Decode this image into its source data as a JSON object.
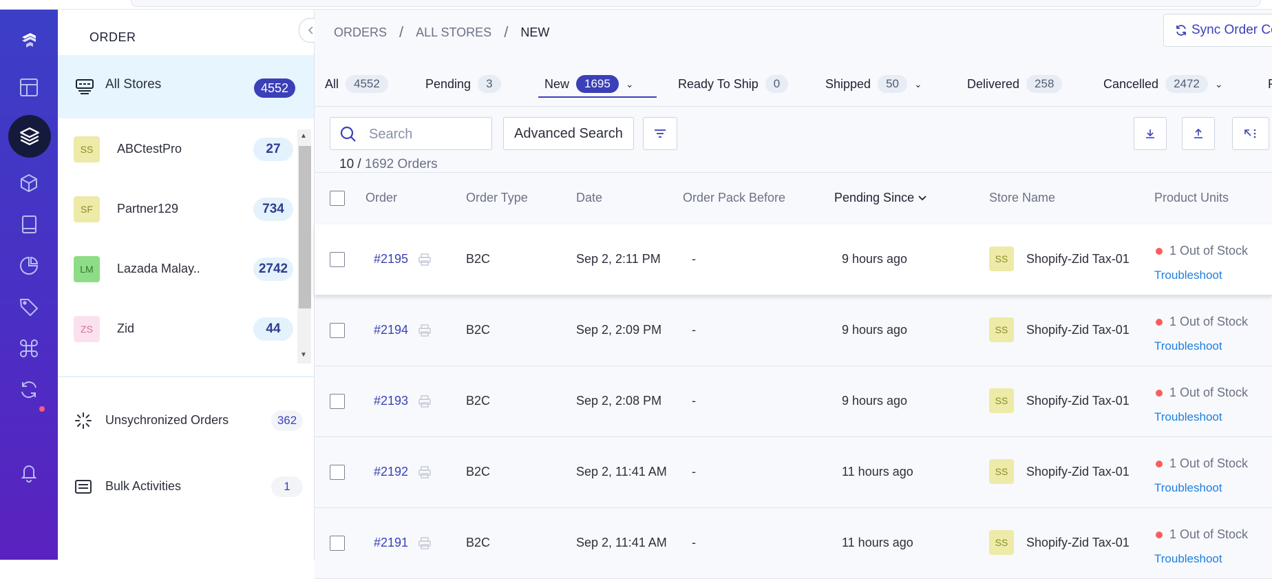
{
  "sidebar_rail": {
    "icons": [
      "logo-icon",
      "dashboard-icon",
      "orders-icon",
      "products-icon",
      "catalog-icon",
      "reports-icon",
      "tags-icon",
      "shortcuts-icon",
      "sync-icon",
      "notifications-icon"
    ]
  },
  "stores_panel": {
    "title": "ORDER",
    "all_stores": {
      "label": "All Stores",
      "count": "4552"
    },
    "stores": [
      {
        "initials": "SS",
        "name": "ABCtestPro",
        "count": "27",
        "bg": "#eeeaa8",
        "fg": "#8a8d2a"
      },
      {
        "initials": "SF",
        "name": "Partner129",
        "count": "734",
        "bg": "#eeeaa8",
        "fg": "#8a8d2a"
      },
      {
        "initials": "LM",
        "name": "Lazada Malay..",
        "count": "2742",
        "bg": "#8fdc86",
        "fg": "#2f7a2a"
      },
      {
        "initials": "ZS",
        "name": "Zid",
        "count": "44",
        "bg": "#fbe1ee",
        "fg": "#d86aa0"
      }
    ],
    "links": [
      {
        "label": "Unsychronized Orders",
        "count": "362"
      },
      {
        "label": "Bulk Activities",
        "count": "1"
      }
    ]
  },
  "breadcrumb": [
    "ORDERS",
    "ALL STORES",
    "NEW"
  ],
  "sync_button": "Sync Order Co",
  "tabs": [
    {
      "label": "All",
      "count": "4552"
    },
    {
      "label": "Pending",
      "count": "3"
    },
    {
      "label": "New",
      "count": "1695"
    },
    {
      "label": "Ready To Ship",
      "count": "0"
    },
    {
      "label": "Shipped",
      "count": "50"
    },
    {
      "label": "Delivered",
      "count": "258"
    },
    {
      "label": "Cancelled",
      "count": "2472"
    },
    {
      "label": "R",
      "count": ""
    }
  ],
  "toolbar": {
    "search_placeholder": "Search",
    "advanced_search": "Advanced Search",
    "shown": "10",
    "total": "1692 Orders"
  },
  "table": {
    "columns": [
      "Order",
      "Order Type",
      "Date",
      "Order Pack Before",
      "Pending Since",
      "Store Name",
      "Product Units"
    ],
    "rows": [
      {
        "order": "#2195",
        "type": "B2C",
        "date": "Sep 2, 2:11 PM",
        "pack_before": "-",
        "pending_since": "9 hours ago",
        "store_initials": "SS",
        "store": "Shopify-Zid Tax-01",
        "units": "1 Out of Stock",
        "action": "Troubleshoot"
      },
      {
        "order": "#2194",
        "type": "B2C",
        "date": "Sep 2, 2:09 PM",
        "pack_before": "-",
        "pending_since": "9 hours ago",
        "store_initials": "SS",
        "store": "Shopify-Zid Tax-01",
        "units": "1 Out of Stock",
        "action": "Troubleshoot"
      },
      {
        "order": "#2193",
        "type": "B2C",
        "date": "Sep 2, 2:08 PM",
        "pack_before": "-",
        "pending_since": "9 hours ago",
        "store_initials": "SS",
        "store": "Shopify-Zid Tax-01",
        "units": "1 Out of Stock",
        "action": "Troubleshoot"
      },
      {
        "order": "#2192",
        "type": "B2C",
        "date": "Sep 2, 11:41 AM",
        "pack_before": "-",
        "pending_since": "11 hours ago",
        "store_initials": "SS",
        "store": "Shopify-Zid Tax-01",
        "units": "1 Out of Stock",
        "action": "Troubleshoot"
      },
      {
        "order": "#2191",
        "type": "B2C",
        "date": "Sep 2, 11:41 AM",
        "pack_before": "-",
        "pending_since": "11 hours ago",
        "store_initials": "SS",
        "store": "Shopify-Zid Tax-01",
        "units": "1 Out of Stock",
        "action": "Troubleshoot"
      }
    ]
  },
  "colors": {
    "accent": "#3b3fb8",
    "link": "#1e7fe0",
    "stock_alert": "#ff5c5c"
  }
}
